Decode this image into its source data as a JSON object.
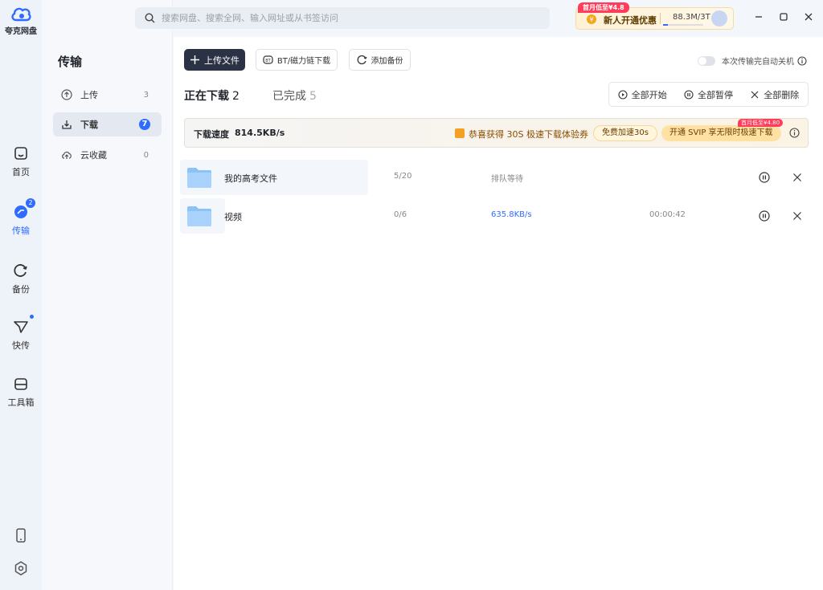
{
  "app": {
    "name": "夸克网盘"
  },
  "rail": {
    "items": [
      {
        "label": "首页",
        "icon": "home-icon"
      },
      {
        "label": "传输",
        "icon": "transfer-icon",
        "badge": "2"
      },
      {
        "label": "备份",
        "icon": "backup-icon"
      },
      {
        "label": "快传",
        "icon": "quick-send-icon"
      },
      {
        "label": "工具箱",
        "icon": "toolbox-icon"
      }
    ]
  },
  "sidebar": {
    "title": "传输",
    "items": [
      {
        "label": "上传",
        "count": "3"
      },
      {
        "label": "下载",
        "count": "7"
      },
      {
        "label": "云收藏",
        "count": "0"
      }
    ]
  },
  "search": {
    "placeholder": "搜索网盘、搜索全网、输入网址或从书签访问"
  },
  "promo": {
    "tag": "首月低至¥4.8",
    "text": "新人开通优惠",
    "storage": "88.3M/3T"
  },
  "toolbar": {
    "upload": "上传文件",
    "bt": "BT/磁力链下载",
    "backup": "添加备份",
    "auto_shutdown": "本次传输完自动关机"
  },
  "tabs": [
    {
      "label": "正在下载",
      "count": "2"
    },
    {
      "label": "已完成",
      "count": "5"
    }
  ],
  "actions": {
    "start_all": "全部开始",
    "pause_all": "全部暂停",
    "delete_all": "全部删除"
  },
  "speedbar": {
    "label": "下载速度",
    "value": "814.5KB/s",
    "message": "恭喜获得 30S 极速下载体验券",
    "boost": "免费加速30s",
    "svip": "开通 SVIP 享无限时极速下载",
    "svip_tag": "首月低至¥4.80"
  },
  "downloads": [
    {
      "name": "我的高考文件",
      "count": "5/20",
      "status": "排队等待",
      "time": ""
    },
    {
      "name": "视频",
      "count": "0/6",
      "status": "635.8KB/s",
      "time": "00:00:42"
    }
  ],
  "colors": {
    "accent": "#2f6bff",
    "primary_button": "#2c3245",
    "promo_red": "#ff3d5a"
  }
}
